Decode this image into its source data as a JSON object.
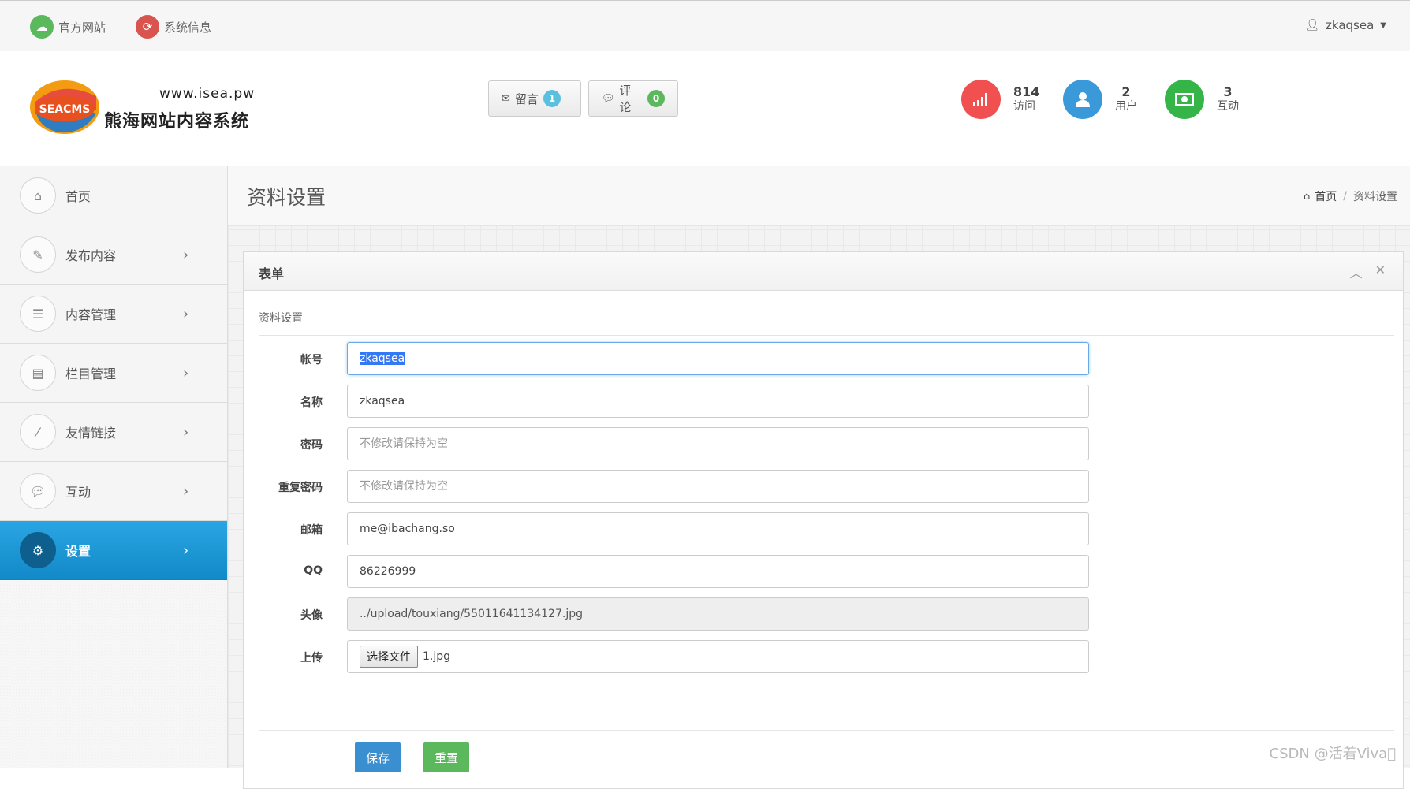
{
  "topbar": {
    "links": [
      {
        "label": "官方网站",
        "icon": "cloud-upload-icon",
        "color": "#5cb85c"
      },
      {
        "label": "系统信息",
        "icon": "refresh-icon",
        "color": "#d9534f"
      }
    ],
    "user": {
      "name": "zkaqsea",
      "icon": "user-icon"
    }
  },
  "header": {
    "logo_text": "SEACMS",
    "site_url": "www.isea.pw",
    "site_name": "熊海网站内容系统",
    "buttons": [
      {
        "label": "留言",
        "count": "1",
        "icon": "envelope-icon",
        "badge_color": "#5bc0de"
      },
      {
        "label": "评论",
        "count": "0",
        "icon": "comments-icon",
        "badge_color": "#5cb85c"
      }
    ],
    "stats": [
      {
        "num": "814",
        "label": "访问",
        "icon": "signal-icon",
        "color": "#f0504f"
      },
      {
        "num": "2",
        "label": "用户",
        "icon": "user-icon",
        "color": "#3a9ad9"
      },
      {
        "num": "3",
        "label": "互动",
        "icon": "money-icon",
        "color": "#35b447"
      }
    ]
  },
  "sidebar": {
    "items": [
      {
        "label": "首页",
        "icon": "home-icon",
        "has_arrow": false,
        "active": false
      },
      {
        "label": "发布内容",
        "icon": "pencil-icon",
        "has_arrow": true,
        "active": false
      },
      {
        "label": "内容管理",
        "icon": "list-icon",
        "has_arrow": true,
        "active": false
      },
      {
        "label": "栏目管理",
        "icon": "list-alt-icon",
        "has_arrow": true,
        "active": false
      },
      {
        "label": "友情链接",
        "icon": "magic-wand-icon",
        "has_arrow": true,
        "active": false
      },
      {
        "label": "互动",
        "icon": "comments-icon",
        "has_arrow": true,
        "active": false
      },
      {
        "label": "设置",
        "icon": "cogs-icon",
        "has_arrow": true,
        "active": true
      }
    ]
  },
  "page": {
    "title": "资料设置",
    "breadcrumb": {
      "home": "首页",
      "current": "资料设置"
    }
  },
  "panel": {
    "title": "表单",
    "legend": "资料设置",
    "fields": {
      "account": {
        "label": "帐号",
        "value": "zkaqsea"
      },
      "name": {
        "label": "名称",
        "value": "zkaqsea"
      },
      "password": {
        "label": "密码",
        "placeholder": "不修改请保持为空"
      },
      "repeat_password": {
        "label": "重复密码",
        "placeholder": "不修改请保持为空"
      },
      "email": {
        "label": "邮箱",
        "value": "me@ibachang.so"
      },
      "qq": {
        "label": "QQ",
        "value": "86226999"
      },
      "avatar": {
        "label": "头像",
        "value": "../upload/touxiang/55011641134127.jpg"
      },
      "upload": {
        "label": "上传",
        "button": "选择文件",
        "filename": "1.jpg"
      }
    },
    "buttons": {
      "save": "保存",
      "reset": "重置"
    }
  },
  "watermark": "CSDN @活着Viva\u0000"
}
